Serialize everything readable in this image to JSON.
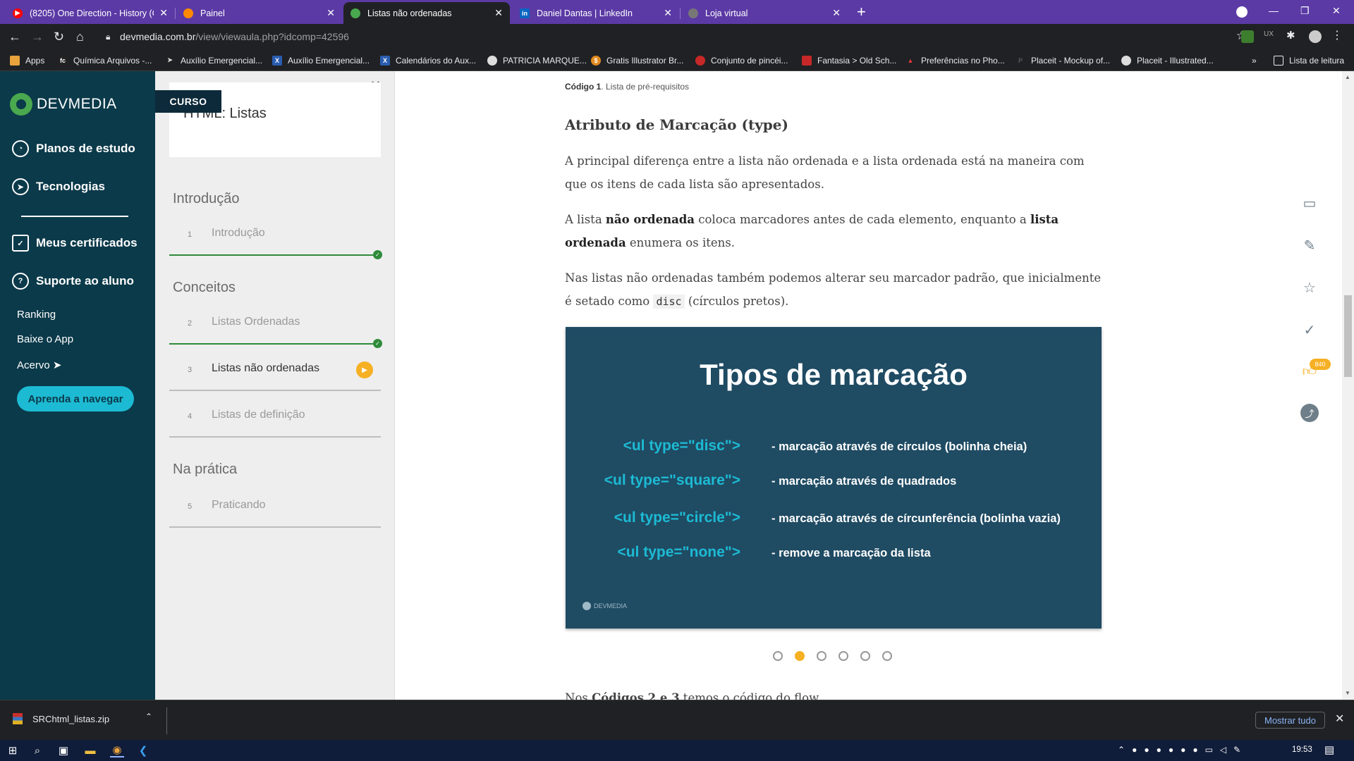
{
  "browser": {
    "tabs": [
      {
        "title": "(8205) One Direction - History (C",
        "favicon": "youtube-icon",
        "color": "#ff0000"
      },
      {
        "title": "Painel",
        "favicon": "painel-icon",
        "color": "#ff8a00"
      },
      {
        "title": "Listas não ordenadas",
        "favicon": "devmedia-icon",
        "color": "#4aa84e",
        "active": true
      },
      {
        "title": "Daniel Dantas | LinkedIn",
        "favicon": "linkedin-icon",
        "color": "#0a66c2"
      },
      {
        "title": "Loja virtual",
        "favicon": "globe-icon",
        "color": "#777777"
      }
    ],
    "url_domain": "devmedia.com.br",
    "url_path": "/view/viewaula.php?idcomp=42596",
    "bookmarks": [
      "Apps",
      "Química Arquivos -...",
      "Auxílio Emergencial...",
      "Auxílio Emergencial...",
      "Calendários do Aux...",
      "PATRICIA MARQUE...",
      "Gratis Illustrator Br...",
      "Conjunto de pincéi...",
      "Fantasia > Old Sch...",
      "Preferências no Pho...",
      "Placeit - Mockup of...",
      "Placeit - Illustrated...",
      "Lista de leitura"
    ]
  },
  "sidebar": {
    "brand": "DEVMEDIA",
    "items": [
      {
        "label": "Planos de estudo"
      },
      {
        "label": "Tecnologias"
      },
      {
        "label": "Meus certificados"
      },
      {
        "label": "Suporte ao aluno"
      }
    ],
    "links": [
      "Ranking",
      "Baixe o App",
      "Acervo ➤"
    ],
    "cta": "Aprenda a navegar"
  },
  "course": {
    "badge": "CURSO",
    "title": "HTML: Listas",
    "sections": [
      {
        "title": "Introdução",
        "lessons": [
          {
            "num": "1",
            "title": "Introdução",
            "done": true
          }
        ]
      },
      {
        "title": "Conceitos",
        "lessons": [
          {
            "num": "2",
            "title": "Listas Ordenadas",
            "done": true
          },
          {
            "num": "3",
            "title": "Listas não ordenadas",
            "current": true
          },
          {
            "num": "4",
            "title": "Listas de definição"
          }
        ]
      },
      {
        "title": "Na prática",
        "lessons": [
          {
            "num": "5",
            "title": "Praticando"
          }
        ]
      }
    ]
  },
  "article": {
    "caption_label": "Código 1",
    "caption_text": ". Lista de pré-requisitos",
    "heading": "Atributo de Marcação (type)",
    "p1": "A principal diferença entre a lista não ordenada e a lista ordenada está na maneira com que os itens de cada lista são apresentados.",
    "p2_a": "A lista ",
    "p2_b": "não ordenada",
    "p2_c": " coloca marcadores antes de cada elemento, enquanto a ",
    "p2_d": "lista ordenada",
    "p2_e": " enumera os itens.",
    "p3_a": "Nas listas não ordenadas também podemos alterar seu marcador padrão, que inicialmente é setado como ",
    "p3_code": "disc",
    "p3_b": " (círculos pretos).",
    "cut_a": "Nos ",
    "cut_b": "Códigos 2 e 3",
    "cut_c": " temos o código do flow"
  },
  "slide": {
    "title": "Tipos de marcação",
    "rows": [
      {
        "tag": "<ul type=\"disc\">",
        "desc": "- marcação através de círculos (bolinha cheia)"
      },
      {
        "tag": "<ul type=\"square\">",
        "desc": "- marcação através de quadrados"
      },
      {
        "tag": "<ul type=\"circle\">",
        "desc": "- marcação através de círcunferência (bolinha vazia)"
      },
      {
        "tag": "<ul type=\"none\">",
        "desc": "- remove a marcação da lista"
      }
    ],
    "logo": "DEVMEDIA",
    "dots": 6,
    "active_dot": 2
  },
  "rail": {
    "like_count": "840"
  },
  "download": {
    "file": "SRChtml_listas.zip",
    "show_all": "Mostrar tudo"
  },
  "taskbar": {
    "time": "19:53"
  },
  "colors": {
    "accent": "#f6b023",
    "brand_dark": "#0b3a4a",
    "teal": "#1dbad3",
    "done_green": "#2e8b3a"
  }
}
